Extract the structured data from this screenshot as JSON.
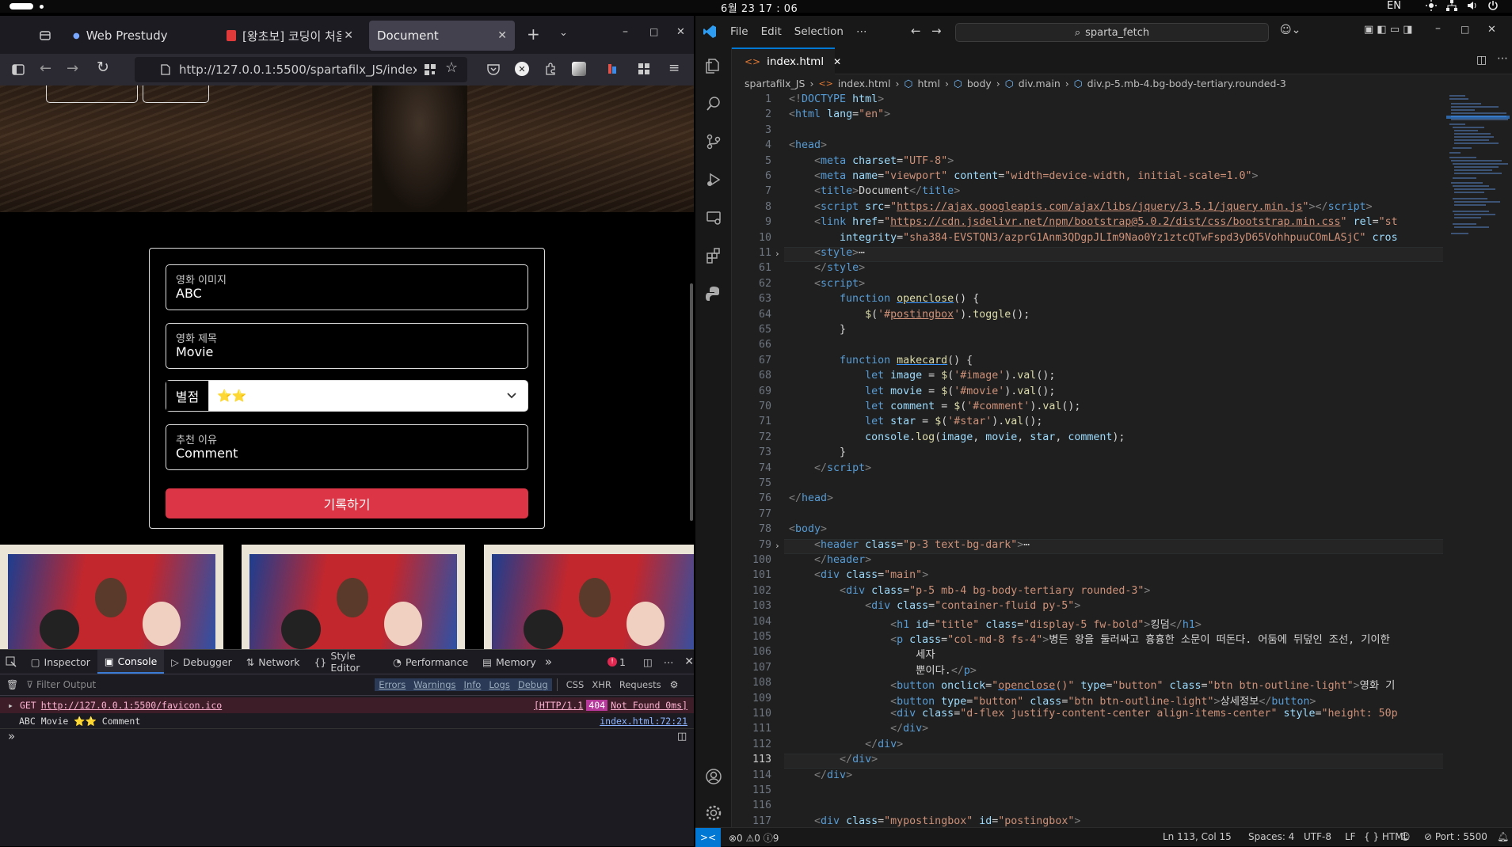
{
  "system": {
    "clock": "6월 23  17 : 06",
    "lang": "EN"
  },
  "firefox": {
    "tabs": [
      {
        "label": "Web Prestudy - Wee"
      },
      {
        "label": "[왕초보] 코딩이 처음이"
      },
      {
        "label": "Document"
      }
    ],
    "url": "http://127.0.0.1:5500/spartafilx_JS/index.h",
    "page": {
      "form": {
        "image_label": "영화 이미지",
        "image_value": "ABC",
        "title_label": "영화 제목",
        "title_value": "Movie",
        "rating_label": "별점",
        "rating_value": "⭐⭐",
        "comment_label": "추천 이유",
        "comment_value": "Comment",
        "submit": "기록하기"
      }
    },
    "devtools": {
      "tabs": [
        "Inspector",
        "Console",
        "Debugger",
        "Network",
        "Style Editor",
        "Performance",
        "Memory"
      ],
      "error_count": "1",
      "filter_placeholder": "Filter Output",
      "filters": [
        "Errors",
        "Warnings",
        "Info",
        "Logs",
        "Debug",
        "CSS",
        "XHR",
        "Requests"
      ],
      "logs": [
        {
          "method": "GET",
          "url": "http://127.0.0.1:5500/favicon.ico",
          "status_pre": "[HTTP/1.1",
          "status_code": "404",
          "status_post": "Not Found 0ms]"
        },
        {
          "text": "ABC Movie ⭐⭐ Comment",
          "source": "index.html:72:21"
        }
      ]
    }
  },
  "vscode": {
    "menu": [
      "File",
      "Edit",
      "Selection",
      "⋯"
    ],
    "search": "sparta_fetch",
    "tab": "index.html",
    "breadcrumb": [
      "spartafilx_JS",
      "index.html",
      "html",
      "body",
      "div.main",
      "div.p-5.mb-4.bg-body-tertiary.rounded-3"
    ],
    "lines": [
      {
        "n": "1",
        "html": "<span class='tg'>&lt;!</span><span class='tn'>DOCTYPE</span> <span class='an'>html</span><span class='tg'>&gt;</span>"
      },
      {
        "n": "2",
        "html": "<span class='tg'>&lt;</span><span class='tn'>html</span> <span class='an'>lang</span>=<span class='av'>\"en\"</span><span class='tg'>&gt;</span>"
      },
      {
        "n": "3",
        "html": ""
      },
      {
        "n": "4",
        "html": "<span class='tg'>&lt;</span><span class='tn'>head</span><span class='tg'>&gt;</span>"
      },
      {
        "n": "5",
        "html": "    <span class='tg'>&lt;</span><span class='tn'>meta</span> <span class='an'>charset</span>=<span class='av'>\"UTF-8\"</span><span class='tg'>&gt;</span>"
      },
      {
        "n": "6",
        "html": "    <span class='tg'>&lt;</span><span class='tn'>meta</span> <span class='an'>name</span>=<span class='av'>\"viewport\"</span> <span class='an'>content</span>=<span class='av'>\"width=device-width, initial-scale=1.0\"</span><span class='tg'>&gt;</span>"
      },
      {
        "n": "7",
        "html": "    <span class='tg'>&lt;</span><span class='tn'>title</span><span class='tg'>&gt;</span><span class='tx'>Document</span><span class='tg'>&lt;/</span><span class='tn'>title</span><span class='tg'>&gt;</span>"
      },
      {
        "n": "8",
        "html": "    <span class='tg'>&lt;</span><span class='tn'>script</span> <span class='an'>src</span>=<span class='av'>\"<u>https://ajax.googleapis.com/ajax/libs/jquery/3.5.1/jquery.min.js</u>\"</span><span class='tg'>&gt;&lt;/</span><span class='tn'>script</span><span class='tg'>&gt;</span>"
      },
      {
        "n": "9",
        "html": "    <span class='tg'>&lt;</span><span class='tn'>link</span> <span class='an'>href</span>=<span class='av'>\"<u>https://cdn.jsdelivr.net/npm/bootstrap@5.0.2/dist/css/bootstrap.min.css</u>\"</span> <span class='an'>rel</span>=<span class='av'>\"st</span>"
      },
      {
        "n": "10",
        "html": "        <span class='an'>integrity</span>=<span class='av'>\"sha384-EVSTQN3/azprG1Anm3QDgpJLIm9Nao0Yz1ztcQTwFspd3yD65VohhpuuCOmLASjC\"</span> <span class='an'>cros</span>"
      },
      {
        "n": "11",
        "fold": true,
        "hl": true,
        "html": "    <span class='tg'>&lt;</span><span class='tn'>style</span><span class='tg'>&gt;</span><span class='tx'>⋯</span>"
      },
      {
        "n": "61",
        "html": "    <span class='tg'>&lt;/</span><span class='tn'>style</span><span class='tg'>&gt;</span>"
      },
      {
        "n": "62",
        "html": "    <span class='tg'>&lt;</span><span class='tn'>script</span><span class='tg'>&gt;</span>"
      },
      {
        "n": "63",
        "html": "        <span class='kw'>function</span> <span class='fn ul'>openclose</span><span class='tx'>() {</span>"
      },
      {
        "n": "64",
        "html": "            <span class='fn'>$</span><span class='tx'>(</span><span class='av'>'#<u>postingbox</u>'</span><span class='tx'>).</span><span class='fn'>toggle</span><span class='tx'>();</span>"
      },
      {
        "n": "65",
        "html": "        <span class='tx'>}</span>"
      },
      {
        "n": "66",
        "html": ""
      },
      {
        "n": "67",
        "html": "        <span class='kw'>function</span> <span class='fn ul'>makecard</span><span class='tx'>() {</span>"
      },
      {
        "n": "68",
        "html": "            <span class='kw'>let</span> <span class='vr'>image</span> <span class='tx'>=</span> <span class='fn'>$</span><span class='tx'>(</span><span class='av'>'#image'</span><span class='tx'>).</span><span class='fn'>val</span><span class='tx'>();</span>"
      },
      {
        "n": "69",
        "html": "            <span class='kw'>let</span> <span class='vr'>movie</span> <span class='tx'>=</span> <span class='fn'>$</span><span class='tx'>(</span><span class='av'>'#movie'</span><span class='tx'>).</span><span class='fn'>val</span><span class='tx'>();</span>"
      },
      {
        "n": "70",
        "html": "            <span class='kw'>let</span> <span class='vr'>comment</span> <span class='tx'>=</span> <span class='fn'>$</span><span class='tx'>(</span><span class='av'>'#comment'</span><span class='tx'>).</span><span class='fn'>val</span><span class='tx'>();</span>"
      },
      {
        "n": "71",
        "html": "            <span class='kw'>let</span> <span class='vr'>star</span> <span class='tx'>=</span> <span class='fn'>$</span><span class='tx'>(</span><span class='av'>'#star'</span><span class='tx'>).</span><span class='fn'>val</span><span class='tx'>();</span>"
      },
      {
        "n": "72",
        "html": "            <span class='vr'>console</span><span class='tx'>.</span><span class='fn'>log</span><span class='tx'>(</span><span class='vr'>image</span><span class='tx'>, </span><span class='vr'>movie</span><span class='tx'>, </span><span class='vr'>star</span><span class='tx'>, </span><span class='vr'>comment</span><span class='tx'>)</span><span class='tx'>;</span>"
      },
      {
        "n": "73",
        "html": "        <span class='tx'>}</span>"
      },
      {
        "n": "74",
        "html": "    <span class='tg'>&lt;/</span><span class='tn'>script</span><span class='tg'>&gt;</span>"
      },
      {
        "n": "75",
        "html": ""
      },
      {
        "n": "76",
        "html": "<span class='tg'>&lt;/</span><span class='tn'>head</span><span class='tg'>&gt;</span>"
      },
      {
        "n": "77",
        "html": ""
      },
      {
        "n": "78",
        "html": "<span class='tg'>&lt;</span><span class='tn'>body</span><span class='tg'>&gt;</span>"
      },
      {
        "n": "79",
        "fold": true,
        "hl": true,
        "html": "    <span class='tg'>&lt;</span><span class='tn'>header</span> <span class='an'>class</span>=<span class='av'>\"p-3 text-bg-dark\"</span><span class='tg'>&gt;</span><span class='tx'>⋯</span>"
      },
      {
        "n": "100",
        "html": "    <span class='tg'>&lt;/</span><span class='tn'>header</span><span class='tg'>&gt;</span>"
      },
      {
        "n": "101",
        "html": "    <span class='tg'>&lt;</span><span class='tn'>div</span> <span class='an'>class</span>=<span class='av'>\"main\"</span><span class='tg'>&gt;</span>"
      },
      {
        "n": "102",
        "html": "        <span class='tg'>&lt;</span><span class='tn'>div</span> <span class='an'>class</span>=<span class='av'>\"p-5 mb-4 bg-body-tertiary rounded-3\"</span><span class='tg'>&gt;</span>"
      },
      {
        "n": "103",
        "html": "            <span class='tg'>&lt;</span><span class='tn'>div</span> <span class='an'>class</span>=<span class='av'>\"container-fluid py-5\"</span><span class='tg'>&gt;</span>"
      },
      {
        "n": "104",
        "html": "                <span class='tg'>&lt;</span><span class='tn'>h1</span> <span class='an'>id</span>=<span class='av'>\"title\"</span> <span class='an'>class</span>=<span class='av'>\"display-5 fw-bold\"</span><span class='tg'>&gt;</span><span class='tx'>킹덤</span><span class='tg'>&lt;/</span><span class='tn'>h1</span><span class='tg'>&gt;</span>"
      },
      {
        "n": "105",
        "html": "                <span class='tg'>&lt;</span><span class='tn'>p</span> <span class='an'>class</span>=<span class='av'>\"col-md-8 fs-4\"</span><span class='tg'>&gt;</span><span class='tx'>병든 왕을 둘러싸고 흉흉한 소문이 떠돈다. 어둠에 뒤덮인 조선, 기이한</span>"
      },
      {
        "n": "106",
        "html": "                    <span class='tx'>세자</span>"
      },
      {
        "n": "107",
        "html": "                    <span class='tx'>뿐이다.</span><span class='tg'>&lt;/</span><span class='tn'>p</span><span class='tg'>&gt;</span>"
      },
      {
        "n": "108",
        "html": "                <span class='tg'>&lt;</span><span class='tn'>button</span> <span class='an'>onclick</span>=<span class='av'>\"<span class='ul'>openclose</span>()\"</span> <span class='an'>type</span>=<span class='av'>\"button\"</span> <span class='an'>class</span>=<span class='av'>\"btn btn-outline-light\"</span><span class='tg'>&gt;</span><span class='tx'>영화 기</span>"
      },
      {
        "n": "109",
        "html": "                <span class='tg'>&lt;</span><span class='tn'>button</span> <span class='an'>type</span>=<span class='av'>\"button\"</span> <span class='an'>class</span>=<span class='av'>\"btn btn-outline-light\"</span><span class='tg'>&gt;</span><span class='tx'>상세정보</span><span class='tg'>&lt;/</span><span class='tn'>button</span><span class='tg'>&gt;</span>"
      },
      {
        "n": "110",
        "html": "                <span class='tg'>&lt;</span><span class='tn'>div</span> <span class='an'>class</span>=<span class='av'>\"d-flex justify-content-center align-items-center\"</span> <span class='an'>style</span>=<span class='av'>\"height: 50p</span>"
      },
      {
        "n": "111",
        "html": "                <span class='tg'>&lt;/</span><span class='tn'>div</span><span class='tg'>&gt;</span>"
      },
      {
        "n": "112",
        "html": "            <span class='tg'>&lt;/</span><span class='tn'>div</span><span class='tg'>&gt;</span>"
      },
      {
        "n": "113",
        "cur": true,
        "html": "        <span class='tg'>&lt;/</span><span class='tn'>div</span><span class='tg'>&gt;</span>"
      },
      {
        "n": "114",
        "html": "    <span class='tg'>&lt;/</span><span class='tn'>div</span><span class='tg'>&gt;</span>"
      },
      {
        "n": "115",
        "html": ""
      },
      {
        "n": "116",
        "html": ""
      },
      {
        "n": "117",
        "html": "    <span class='tg'>&lt;</span><span class='tn'>div</span> <span class='an'>class</span>=<span class='av'>\"mypostingbox\"</span> <span class='an'>id</span>=<span class='av'>\"postingbox\"</span><span class='tg'>&gt;</span>"
      },
      {
        "n": "118",
        "html": "        <span class='tg'>&lt;</span><span class='tn'>div</span> <span class='an'>class</span>=<span class='av'>\"form-floating mb-3\"</span><span class='tg'>&gt;</span>"
      }
    ],
    "status": {
      "problems": "⊗0 ⚠0 ⓘ9",
      "position": "Ln 113, Col 15",
      "spaces": "Spaces: 4",
      "encoding": "UTF-8",
      "eol": "LF",
      "language": "{ } HTML",
      "port": "⊘ Port : 5500"
    }
  }
}
